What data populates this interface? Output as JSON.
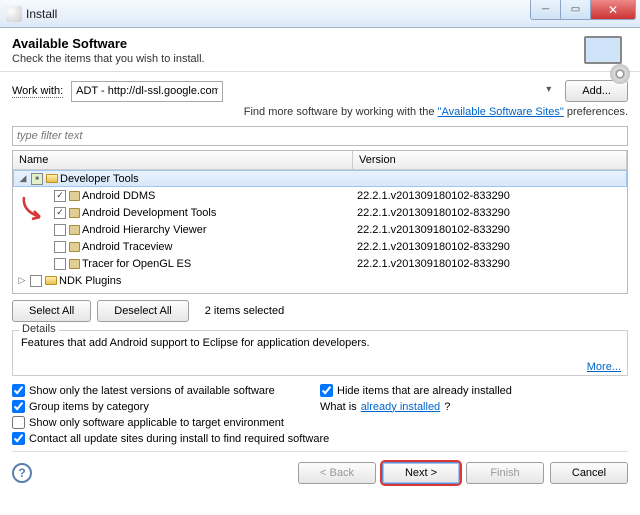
{
  "win": {
    "title": "Install"
  },
  "header": {
    "title": "Available Software",
    "subtitle": "Check the items that you wish to install."
  },
  "workwith": {
    "label": "Work with:",
    "value": "ADT - http://dl-ssl.google.com/android/eclipse",
    "add": "Add..."
  },
  "findmore": {
    "prefix": "Find more software by working with the ",
    "link": "\"Available Software Sites\"",
    "suffix": " preferences."
  },
  "filter": {
    "placeholder": "type filter text"
  },
  "columns": {
    "name": "Name",
    "version": "Version"
  },
  "tree": [
    {
      "label": "Developer Tools",
      "state": "partial",
      "expanded": true,
      "children": [
        {
          "label": "Android DDMS",
          "version": "22.2.1.v201309180102-833290",
          "checked": true
        },
        {
          "label": "Android Development Tools",
          "version": "22.2.1.v201309180102-833290",
          "checked": true
        },
        {
          "label": "Android Hierarchy Viewer",
          "version": "22.2.1.v201309180102-833290",
          "checked": false
        },
        {
          "label": "Android Traceview",
          "version": "22.2.1.v201309180102-833290",
          "checked": false
        },
        {
          "label": "Tracer for OpenGL ES",
          "version": "22.2.1.v201309180102-833290",
          "checked": false
        }
      ]
    },
    {
      "label": "NDK Plugins",
      "state": "unchecked",
      "expanded": false
    }
  ],
  "selbtns": {
    "selectAll": "Select All",
    "deselectAll": "Deselect All",
    "status": "2 items selected"
  },
  "details": {
    "label": "Details",
    "text": "Features that add Android support to Eclipse for application developers.",
    "more": "More..."
  },
  "opts": {
    "o1": "Show only the latest versions of available software",
    "o2": "Hide items that are already installed",
    "o3": "Group items by category",
    "o4a": "What is ",
    "o4b": "already installed",
    "o4c": "?",
    "o5": "Show only software applicable to target environment",
    "o6": "Contact all update sites during install to find required software"
  },
  "footer": {
    "back": "< Back",
    "next": "Next >",
    "finish": "Finish",
    "cancel": "Cancel"
  }
}
